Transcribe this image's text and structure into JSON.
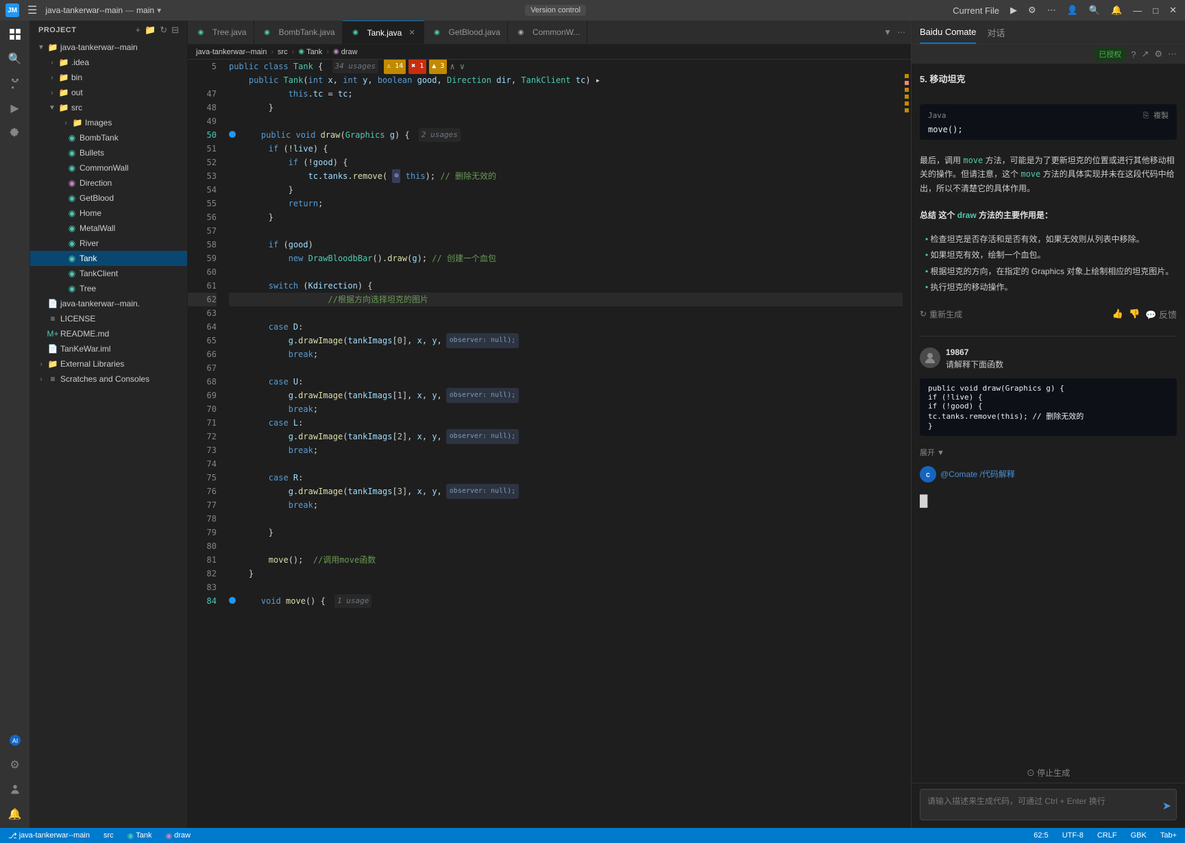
{
  "titlebar": {
    "logo_text": "JM",
    "project_name": "java-tankerwar--main",
    "branch": "main",
    "vcs_label": "Version control",
    "current_file_label": "Current File",
    "dropdown_arrow": "▾"
  },
  "tabs": [
    {
      "id": "tree",
      "label": "Tree.java",
      "icon": "◉",
      "active": false,
      "modified": false
    },
    {
      "id": "bombtank",
      "label": "BombTank.java",
      "icon": "◉",
      "active": false,
      "modified": false
    },
    {
      "id": "tank",
      "label": "Tank.java",
      "icon": "◉",
      "active": true,
      "modified": false
    },
    {
      "id": "getblood",
      "label": "GetBlood.java",
      "icon": "◉",
      "active": false,
      "modified": false
    },
    {
      "id": "commonw",
      "label": "CommonW...",
      "icon": "◉",
      "active": false,
      "modified": false
    }
  ],
  "breadcrumb": {
    "items": [
      "java-tankerwar--main",
      "src",
      "Tank",
      "draw"
    ]
  },
  "sidebar": {
    "title": "Project",
    "root": {
      "name": "java-tankerwar--main",
      "children": [
        {
          "name": ".idea",
          "type": "folder",
          "indent": 1
        },
        {
          "name": "bin",
          "type": "folder",
          "indent": 1
        },
        {
          "name": "out",
          "type": "folder",
          "indent": 1
        },
        {
          "name": "src",
          "type": "folder-open",
          "indent": 1,
          "children": [
            {
              "name": "Images",
              "type": "folder",
              "indent": 2
            },
            {
              "name": "BombTank",
              "type": "java",
              "indent": 2
            },
            {
              "name": "Bullets",
              "type": "java",
              "indent": 2
            },
            {
              "name": "CommonWall",
              "type": "java",
              "indent": 2
            },
            {
              "name": "Direction",
              "type": "java-interface",
              "indent": 2
            },
            {
              "name": "GetBlood",
              "type": "java",
              "indent": 2
            },
            {
              "name": "Home",
              "type": "java",
              "indent": 2
            },
            {
              "name": "MetalWall",
              "type": "java",
              "indent": 2
            },
            {
              "name": "River",
              "type": "java",
              "indent": 2
            },
            {
              "name": "Tank",
              "type": "java",
              "indent": 2,
              "active": true
            },
            {
              "name": "TankClient",
              "type": "java",
              "indent": 2
            },
            {
              "name": "Tree",
              "type": "java",
              "indent": 2
            }
          ]
        },
        {
          "name": "java-tankerwar--main.",
          "type": "file-iml",
          "indent": 1
        },
        {
          "name": "LICENSE",
          "type": "file",
          "indent": 1
        },
        {
          "name": "README.md",
          "type": "file-md",
          "indent": 1
        },
        {
          "name": "TanKeWar.iml",
          "type": "file-iml",
          "indent": 1
        }
      ]
    },
    "external_libraries": "External Libraries",
    "scratches": "Scratches and Consoles"
  },
  "code": {
    "lines": [
      {
        "num": "5",
        "content": "    public class Tank {",
        "hint": "34 usages",
        "warn": "⚠ 14",
        "err1": "✖ 1",
        "err2": "▲ 3"
      },
      {
        "num": "47",
        "content": "        this.tc = tc;"
      },
      {
        "num": "48",
        "content": "    }"
      },
      {
        "num": "49",
        "content": ""
      },
      {
        "num": "50",
        "content": "    public void draw(Graphics g) {",
        "hint": "2 usages",
        "bp": true
      },
      {
        "num": "51",
        "content": "        if (!live) {"
      },
      {
        "num": "52",
        "content": "            if (!good) {"
      },
      {
        "num": "53",
        "content": "                tc.tanks.remove(  this); // 删除无效的"
      },
      {
        "num": "54",
        "content": "            }"
      },
      {
        "num": "55",
        "content": "            return;"
      },
      {
        "num": "56",
        "content": "        }"
      },
      {
        "num": "57",
        "content": ""
      },
      {
        "num": "58",
        "content": "        if (good)"
      },
      {
        "num": "59",
        "content": "            new DrawBloodbBar().draw(g); // 创建一个血包"
      },
      {
        "num": "60",
        "content": ""
      },
      {
        "num": "61",
        "content": "        switch (Kdirection) {"
      },
      {
        "num": "62",
        "content": "                    //根据方向选择坦克的图片",
        "cursor": true
      },
      {
        "num": "63",
        "content": ""
      },
      {
        "num": "64",
        "content": "        case D:"
      },
      {
        "num": "65",
        "content": "            g.drawImage(tankImags[0], x, y,",
        "observer": "observer: null);"
      },
      {
        "num": "66",
        "content": "            break;"
      },
      {
        "num": "67",
        "content": ""
      },
      {
        "num": "68",
        "content": "        case U:"
      },
      {
        "num": "69",
        "content": "            g.drawImage(tankImags[1], x, y,",
        "observer": "observer: null);"
      },
      {
        "num": "70",
        "content": "            break;"
      },
      {
        "num": "71",
        "content": "        case L:"
      },
      {
        "num": "72",
        "content": "            g.drawImage(tankImags[2], x, y,",
        "observer": "observer: null);"
      },
      {
        "num": "73",
        "content": "            break;"
      },
      {
        "num": "74",
        "content": ""
      },
      {
        "num": "75",
        "content": "        case R:"
      },
      {
        "num": "76",
        "content": "            g.drawImage(tankImags[3], x, y,",
        "observer": "observer: null);"
      },
      {
        "num": "77",
        "content": "            break;"
      },
      {
        "num": "78",
        "content": ""
      },
      {
        "num": "79",
        "content": "        }"
      },
      {
        "num": "80",
        "content": ""
      },
      {
        "num": "81",
        "content": "        move();  //调用move函数"
      },
      {
        "num": "82",
        "content": "    }"
      },
      {
        "num": "83",
        "content": ""
      },
      {
        "num": "84",
        "content": "    void move() {",
        "hint": "1 usage",
        "bp": true
      }
    ]
  },
  "right_panel": {
    "tabs": [
      "Baidu Comate",
      "对话"
    ],
    "active_tab": "Baidu Comate",
    "auth_label": "已授权",
    "section_title": "5. 移动坦克",
    "code_lang": "Java",
    "copy_label": "複製",
    "code_content": "move();",
    "ai_text_1": "最后，调用 move 方法，可能是为了更新坦克的位置或进行其他移动相关的操作。但请注意，这个 move 方法的具体实现并未在这段代码中给出，所以不清楚它的具体作用。",
    "summary_label": "总结 这个 draw 方法的主要作用是：",
    "bullets": [
      "检查坦克是否存活和是否有效，如果无效则从列表中移除。",
      "如果坦克有效，绘制一个血包。",
      "根据坦克的方向，在指定的 Graphics 对象上绘制相应的坦克图片。",
      "执行坦克的移动操作。"
    ],
    "regen_label": "重新生成",
    "user_id": "19867",
    "user_question": "请解释下面函数",
    "expandable_code_lines": [
      "public void draw(Graphics g) {",
      "    if (!live) {",
      "        if (!good) {",
      "            tc.tanks.remove(this); // 删除无效的",
      "        }"
    ],
    "expand_label": "展开 ▼",
    "at_comate": "@Comate /代码解释",
    "cursor_char": "█",
    "stop_label": "⊙ 停止生成",
    "input_placeholder": "请输入描述来生成代码，可通过 Ctrl + Enter 换行"
  },
  "statusbar": {
    "branch": "java-tankerwar--main",
    "src": "src",
    "tank_class": "Tank",
    "draw_method": "draw",
    "position": "62:5",
    "encoding": "UTF-8",
    "line_ending": "CRLF",
    "file_encoding": "GBK",
    "indent": "Tab+"
  },
  "icons": {
    "menu": "☰",
    "search": "🔍",
    "run": "▶",
    "debug": "⚙",
    "more": "⋯",
    "user": "👤",
    "bell": "🔔",
    "minimize": "—",
    "maximize": "□",
    "close": "✕",
    "chevron_down": "▾",
    "folder": "📁",
    "file": "📄",
    "arrow_right": "›",
    "arrow_down": "∨",
    "send": "➤",
    "refresh": "↻",
    "thumbup": "👍",
    "thumbdown": "👎",
    "feedback": "💬",
    "copy": "⎘"
  }
}
